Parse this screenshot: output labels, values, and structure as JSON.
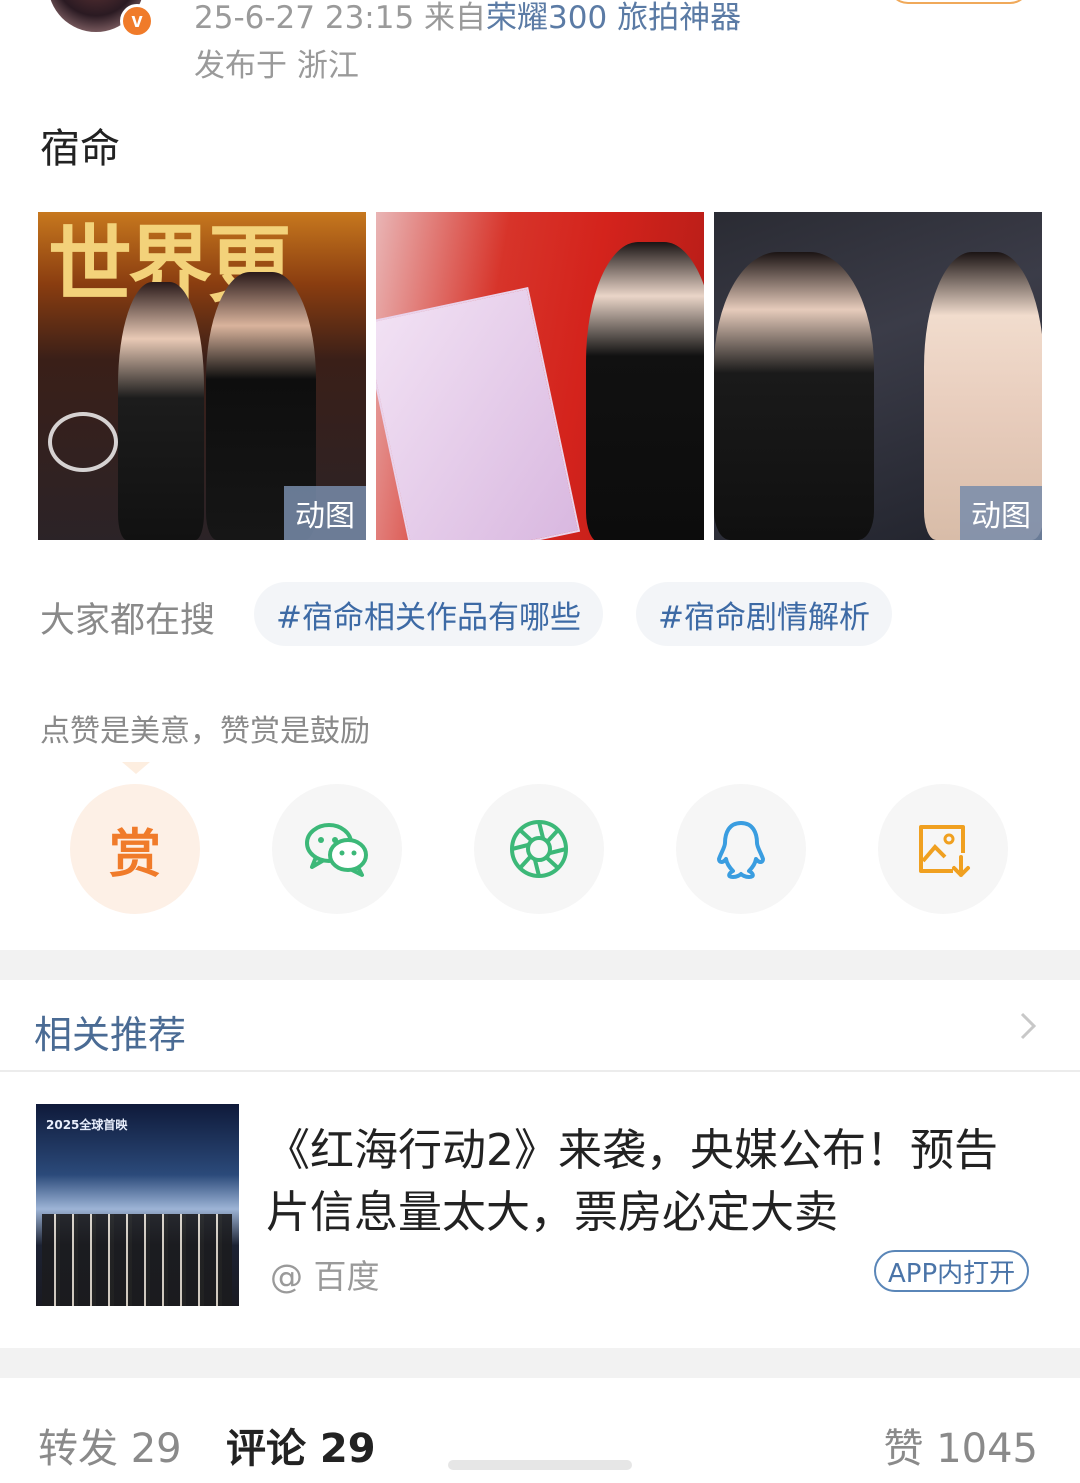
{
  "post": {
    "meta_time": "25-6-27 23:15  来自",
    "meta_source": "荣耀300 旅拍神器",
    "location": "发布于 浙江",
    "verified_badge": "v",
    "text": "宿命",
    "images": [
      {
        "badge": "动图",
        "overlay_text": "世界更"
      },
      {
        "badge": ""
      },
      {
        "badge": "动图"
      }
    ]
  },
  "search": {
    "label": "大家都在搜",
    "tags": [
      "#宿命相关作品有哪些",
      "#宿命剧情解析"
    ]
  },
  "reward_tip": "点赞是美意，赞赏是鼓励",
  "share": {
    "reward_label": "赏",
    "icons": [
      "reward-icon",
      "wechat-icon",
      "moments-icon",
      "qq-icon",
      "save-image-icon"
    ]
  },
  "recommend": {
    "title": "相关推荐",
    "card": {
      "thumb_label": "2025全球首映",
      "headline": "《红海行动2》来袭，央媒公布！预告片信息量太大，票房必定大卖",
      "source": "@ 百度",
      "open_button": "APP内打开"
    }
  },
  "stats": {
    "repost": "转发 29",
    "comment": "评论 29",
    "like": "赞 1045"
  },
  "colors": {
    "link_blue": "#3d6aa5",
    "accent_orange": "#f07b2a",
    "muted_gray": "#9a9a9a"
  }
}
